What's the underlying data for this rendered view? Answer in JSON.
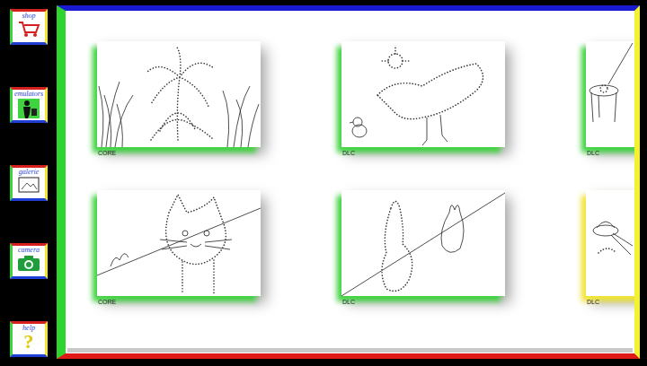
{
  "sidebar": {
    "items": [
      {
        "label": "shop",
        "glyph": ""
      },
      {
        "label": "emulators",
        "glyph": ""
      },
      {
        "label": "galerie",
        "glyph": ""
      },
      {
        "label": "camera",
        "glyph": ""
      },
      {
        "label": "help",
        "glyph": "?"
      }
    ]
  },
  "gallery": {
    "cards": [
      {
        "badge": "CORE",
        "color": "#3fd43f"
      },
      {
        "badge": "DLC",
        "color": "#3fd43f"
      },
      {
        "badge": "DLC",
        "color": "#3fd43f"
      },
      {
        "badge": "CORE",
        "color": "#3fd43f"
      },
      {
        "badge": "DLC",
        "color": "#3fd43f"
      },
      {
        "badge": "DLC",
        "color": "#f2e632"
      }
    ]
  }
}
